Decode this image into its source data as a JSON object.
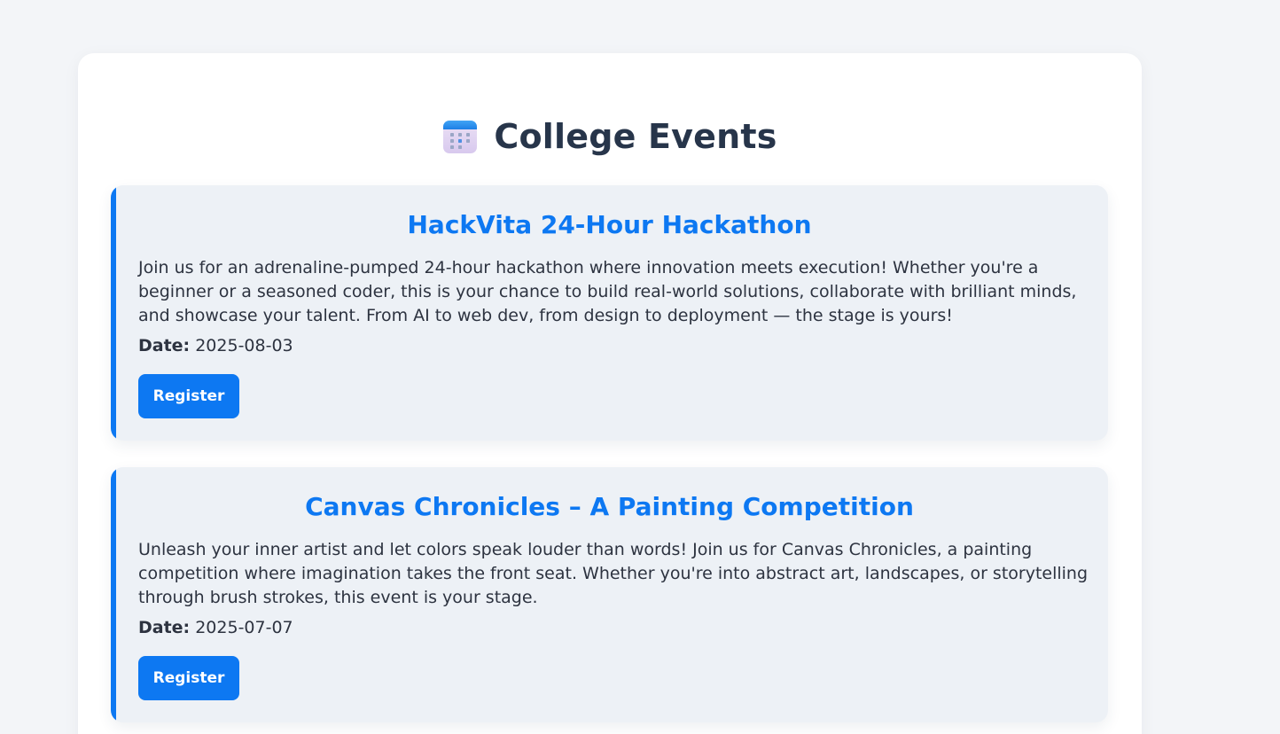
{
  "header": {
    "title": "College Events",
    "icon": "calendar-icon"
  },
  "events": [
    {
      "title": "HackVita 24-Hour Hackathon",
      "description": "Join us for an adrenaline-pumped 24-hour hackathon where innovation meets execution! Whether you're a beginner or a seasoned coder, this is your chance to build real-world solutions, collaborate with brilliant minds, and showcase your talent. From AI to web dev, from design to deployment — the stage is yours!",
      "date_label": "Date:",
      "date": "2025-08-03",
      "register_label": "Register"
    },
    {
      "title": "Canvas Chronicles – A Painting Competition",
      "description": "Unleash your inner artist and let colors speak louder than words! Join us for Canvas Chronicles, a painting competition where imagination takes the front seat. Whether you're into abstract art, landscapes, or storytelling through brush strokes, this event is your stage.",
      "date_label": "Date:",
      "date": "2025-07-07",
      "register_label": "Register"
    }
  ],
  "colors": {
    "accent": "#0d78f2",
    "card_bg": "#edf1f6",
    "page_bg": "#f3f5f8",
    "title": "#27354a"
  }
}
